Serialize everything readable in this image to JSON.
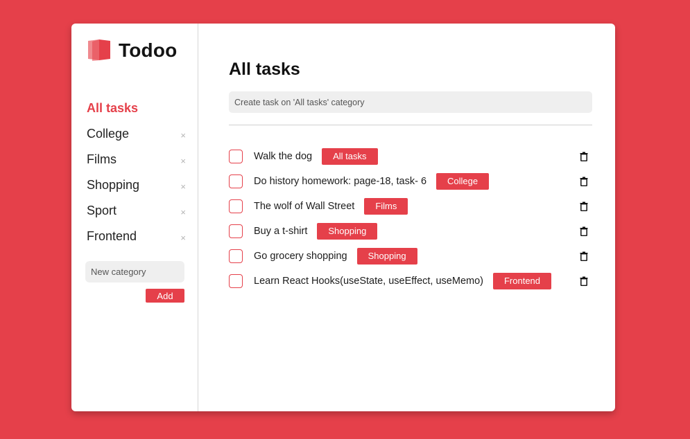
{
  "app": {
    "name": "Todoo"
  },
  "sidebar": {
    "categories": [
      {
        "label": "All tasks",
        "active": true,
        "removable": false
      },
      {
        "label": "College",
        "active": false,
        "removable": true
      },
      {
        "label": "Films",
        "active": false,
        "removable": true
      },
      {
        "label": "Shopping",
        "active": false,
        "removable": true
      },
      {
        "label": "Sport",
        "active": false,
        "removable": true
      },
      {
        "label": "Frontend",
        "active": false,
        "removable": true
      }
    ],
    "remove_glyph": "×",
    "new_category_placeholder": "New category",
    "add_label": "Add"
  },
  "main": {
    "title": "All tasks",
    "task_input_placeholder": "Create task on 'All tasks' category",
    "tasks": [
      {
        "text": "Walk the dog",
        "tag": "All tasks",
        "done": false
      },
      {
        "text": "Do history homework: page-18, task- 6",
        "tag": "College",
        "done": false
      },
      {
        "text": "The wolf of Wall Street",
        "tag": "Films",
        "done": false
      },
      {
        "text": "Buy a t-shirt",
        "tag": "Shopping",
        "done": false
      },
      {
        "text": "Go grocery shopping",
        "tag": "Shopping",
        "done": false
      },
      {
        "text": "Learn React Hooks(useState, useEffect, useMemo)",
        "tag": "Frontend",
        "done": false
      }
    ]
  },
  "colors": {
    "accent": "#e5404a",
    "logo_light": "#f08a8f",
    "background": "#e5404a",
    "card": "#ffffff"
  },
  "icons": {
    "logo": "book-icon",
    "remove": "close-icon",
    "delete": "trash-icon"
  }
}
